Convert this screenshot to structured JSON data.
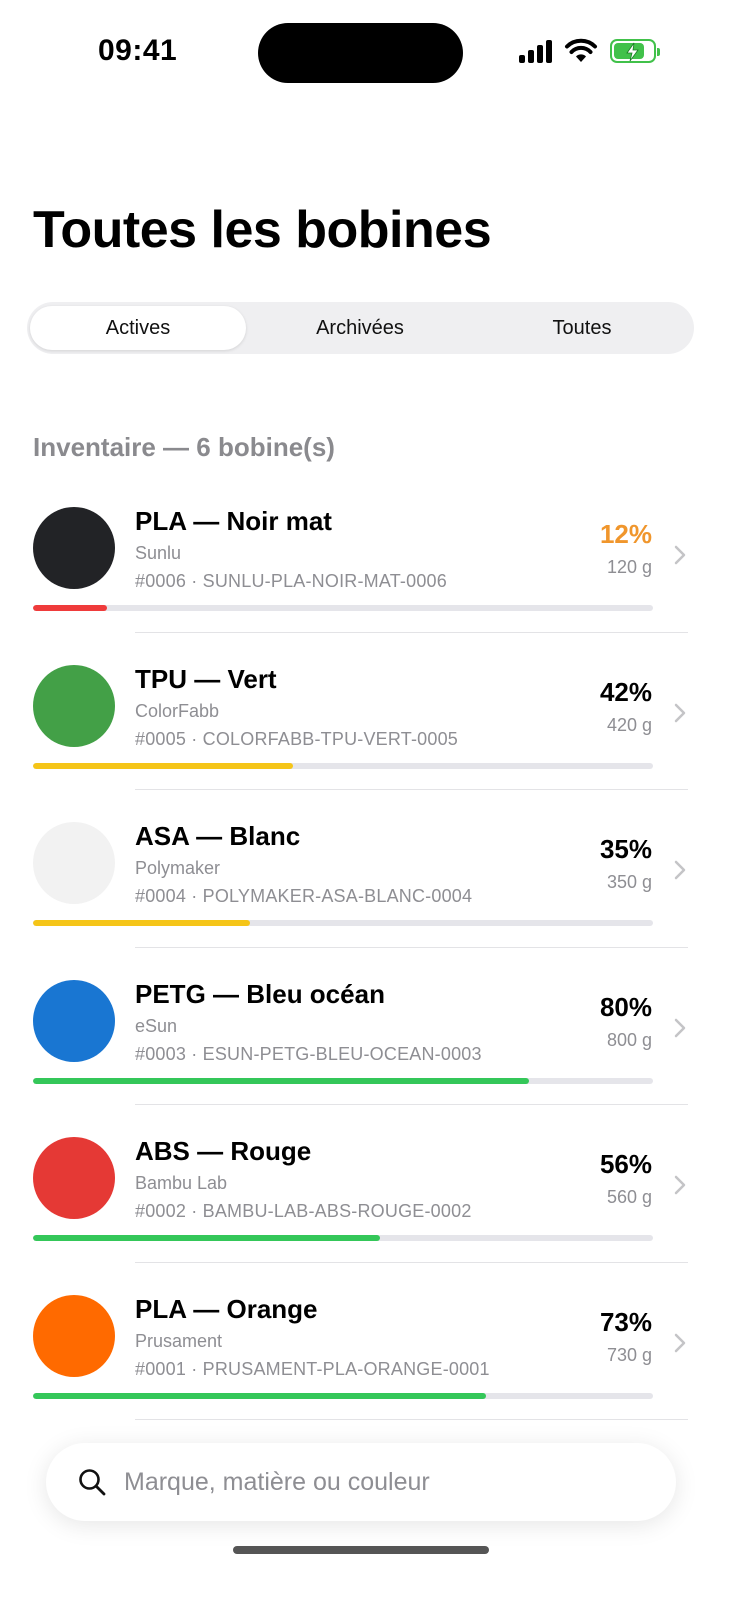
{
  "status_bar": {
    "time": "09:41"
  },
  "page": {
    "title": "Toutes les bobines"
  },
  "segments": {
    "active": "Actives",
    "archived": "Archivées",
    "all": "Toutes"
  },
  "section": {
    "header": "Inventaire — 6 bobine(s)"
  },
  "spools": [
    {
      "title": "PLA — Noir mat",
      "brand": "Sunlu",
      "code": "#0006 · SUNLU-PLA-NOIR-MAT-0006",
      "percent": "12%",
      "weight": "120 g",
      "level": 0.12,
      "swatch": "#222326",
      "bar_color": "#ef3b3b",
      "percent_color": "#f0962c"
    },
    {
      "title": "TPU — Vert",
      "brand": "ColorFabb",
      "code": "#0005 · COLORFABB-TPU-VERT-0005",
      "percent": "42%",
      "weight": "420 g",
      "level": 0.42,
      "swatch": "#43a047",
      "bar_color": "#f5c518",
      "percent_color": "#000000"
    },
    {
      "title": "ASA — Blanc",
      "brand": "Polymaker",
      "code": "#0004 · POLYMAKER-ASA-BLANC-0004",
      "percent": "35%",
      "weight": "350 g",
      "level": 0.35,
      "swatch": "#f2f2f2",
      "bar_color": "#f5c518",
      "percent_color": "#000000"
    },
    {
      "title": "PETG — Bleu océan",
      "brand": "eSun",
      "code": "#0003 · ESUN-PETG-BLEU-OCEAN-0003",
      "percent": "80%",
      "weight": "800 g",
      "level": 0.8,
      "swatch": "#1976d2",
      "bar_color": "#34c759",
      "percent_color": "#000000"
    },
    {
      "title": "ABS — Rouge",
      "brand": "Bambu Lab",
      "code": "#0002 · BAMBU-LAB-ABS-ROUGE-0002",
      "percent": "56%",
      "weight": "560 g",
      "level": 0.56,
      "swatch": "#e53935",
      "bar_color": "#34c759",
      "percent_color": "#000000"
    },
    {
      "title": "PLA — Orange",
      "brand": "Prusament",
      "code": "#0001 · PRUSAMENT-PLA-ORANGE-0001",
      "percent": "73%",
      "weight": "730 g",
      "level": 0.73,
      "swatch": "#ff6a00",
      "bar_color": "#34c759",
      "percent_color": "#000000"
    }
  ],
  "search": {
    "placeholder": "Marque, matière ou couleur",
    "value": ""
  },
  "icons": {
    "search": "magnifier-icon",
    "chevron": "chevron-right-icon",
    "signal": "cellular-signal-icon",
    "wifi": "wifi-icon",
    "battery": "battery-charging-icon"
  }
}
